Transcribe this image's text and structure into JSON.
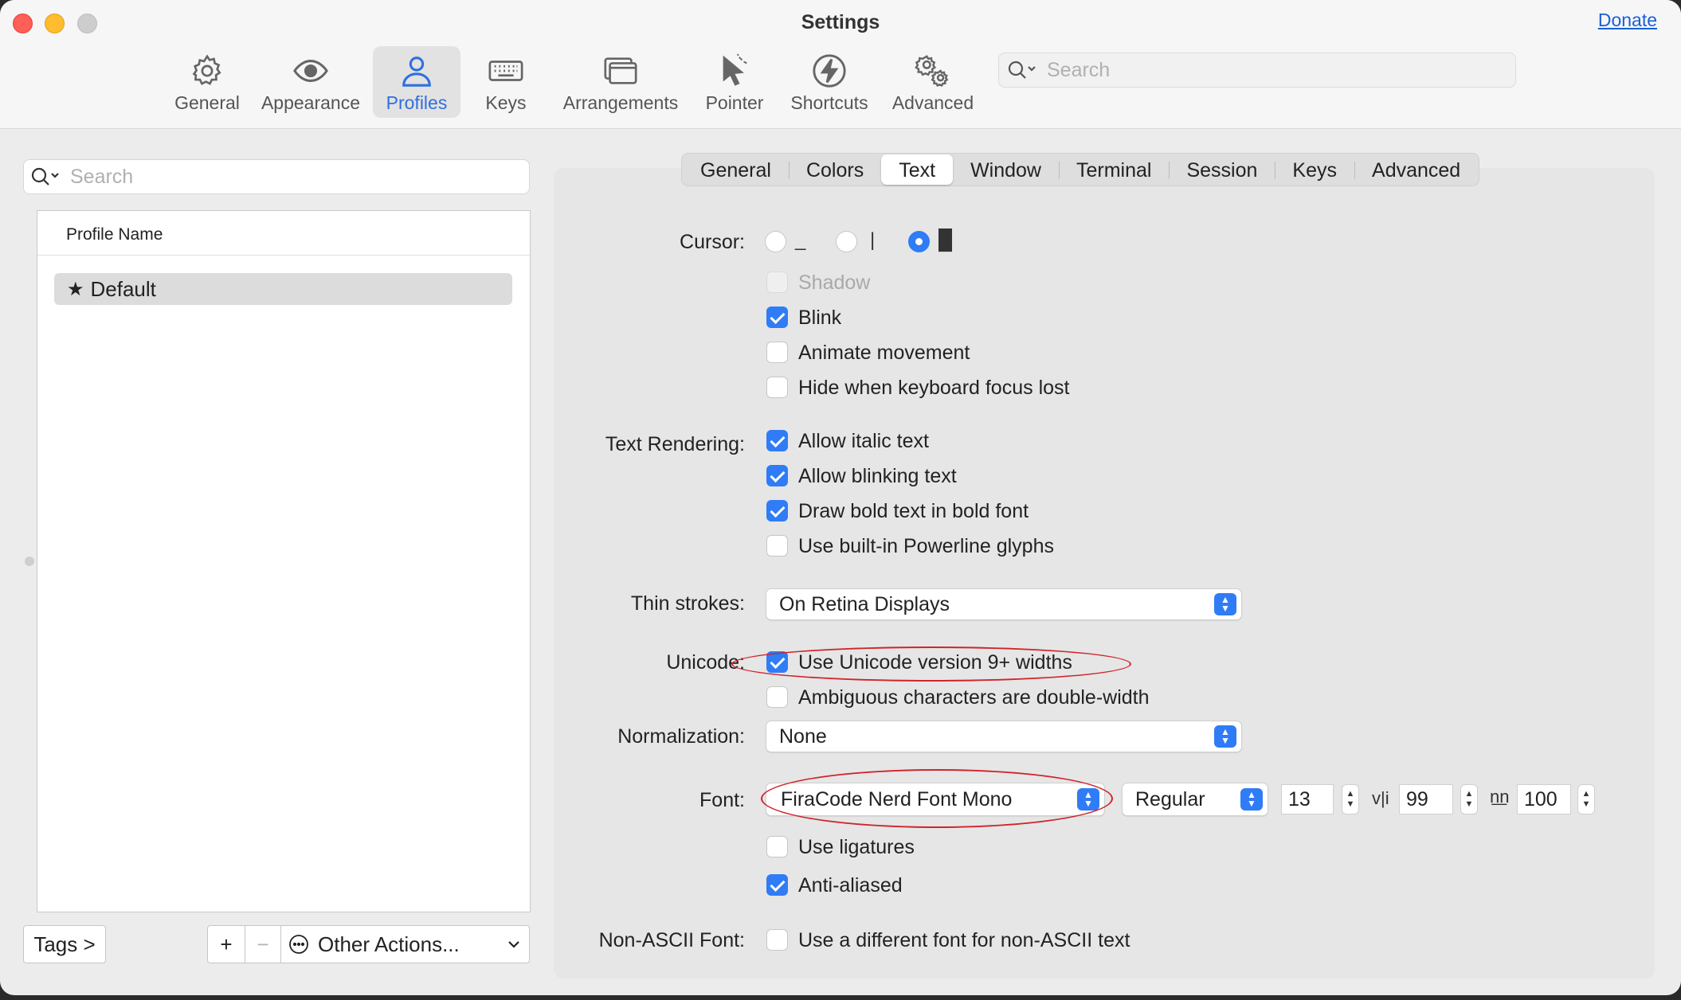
{
  "window": {
    "title": "Settings",
    "donate_label": "Donate"
  },
  "toolbar": {
    "items": [
      {
        "label": "General",
        "icon": "gear-icon"
      },
      {
        "label": "Appearance",
        "icon": "eye-icon"
      },
      {
        "label": "Profiles",
        "icon": "person-icon",
        "active": true
      },
      {
        "label": "Keys",
        "icon": "keyboard-icon"
      },
      {
        "label": "Arrangements",
        "icon": "windows-icon"
      },
      {
        "label": "Pointer",
        "icon": "pointer-icon"
      },
      {
        "label": "Shortcuts",
        "icon": "bolt-icon"
      },
      {
        "label": "Advanced",
        "icon": "gears-icon"
      }
    ],
    "search_placeholder": "Search"
  },
  "sidebar": {
    "search_placeholder": "Search",
    "column_header": "Profile Name",
    "profiles": [
      {
        "name": "Default",
        "default": true
      }
    ],
    "tags_label": "Tags >",
    "add_label": "+",
    "remove_label": "−",
    "other_actions_label": "Other Actions..."
  },
  "tabs": [
    {
      "label": "General"
    },
    {
      "label": "Colors"
    },
    {
      "label": "Text",
      "active": true
    },
    {
      "label": "Window"
    },
    {
      "label": "Terminal"
    },
    {
      "label": "Session"
    },
    {
      "label": "Keys"
    },
    {
      "label": "Advanced"
    }
  ],
  "text_settings": {
    "cursor_label": "Cursor:",
    "cursor_options": [
      {
        "glyph": "_",
        "selected": false
      },
      {
        "glyph": "|",
        "selected": false
      },
      {
        "glyph": "█",
        "selected": true
      }
    ],
    "cursor_checks": [
      {
        "label": "Shadow",
        "checked": false,
        "disabled": true
      },
      {
        "label": "Blink",
        "checked": true
      },
      {
        "label": "Animate movement",
        "checked": false
      },
      {
        "label": "Hide when keyboard focus lost",
        "checked": false
      }
    ],
    "rendering_label": "Text Rendering:",
    "rendering_checks": [
      {
        "label": "Allow italic text",
        "checked": true
      },
      {
        "label": "Allow blinking text",
        "checked": true
      },
      {
        "label": "Draw bold text in bold font",
        "checked": true
      },
      {
        "label": "Use built-in Powerline glyphs",
        "checked": false
      }
    ],
    "thin_strokes_label": "Thin strokes:",
    "thin_strokes_value": "On Retina Displays",
    "unicode_label": "Unicode:",
    "unicode_checks": [
      {
        "label": "Use Unicode version 9+ widths",
        "checked": true
      },
      {
        "label": "Ambiguous characters are double-width",
        "checked": false
      }
    ],
    "normalization_label": "Normalization:",
    "normalization_value": "None",
    "font_label": "Font:",
    "font_family": "FiraCode Nerd Font Mono",
    "font_weight": "Regular",
    "font_size": "13",
    "vertical_spacing_glyph": "v|i",
    "vertical_spacing": "99",
    "horizontal_spacing_glyph": "n͟n",
    "horizontal_spacing": "100",
    "font_checks": [
      {
        "label": "Use ligatures",
        "checked": false
      },
      {
        "label": "Anti-aliased",
        "checked": true
      }
    ],
    "non_ascii_label": "Non-ASCII Font:",
    "non_ascii_check": {
      "label": "Use a different font for non-ASCII text",
      "checked": false
    }
  },
  "colors": {
    "accent": "#2f7cf6",
    "annotation": "#d0242a"
  }
}
